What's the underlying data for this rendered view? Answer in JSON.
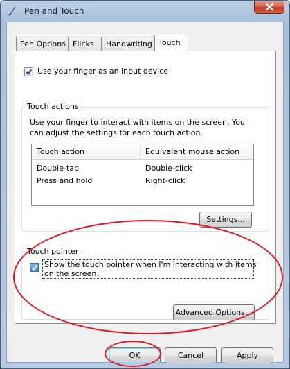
{
  "window": {
    "title": "Pen and Touch",
    "accent_close": "#c23b22"
  },
  "tabs": [
    {
      "label": "Pen Options",
      "active": false
    },
    {
      "label": "Flicks",
      "active": false
    },
    {
      "label": "Handwriting",
      "active": false
    },
    {
      "label": "Touch",
      "active": true
    }
  ],
  "use_finger": {
    "checked": true,
    "label": "Use your finger as an input device"
  },
  "touch_actions": {
    "legend": "Touch actions",
    "description_line1": "Use your finger to interact with items on the screen. You",
    "description_line2": "can adjust the settings for each touch action.",
    "columns": [
      "Touch action",
      "Equivalent mouse action"
    ],
    "rows": [
      {
        "action": "Double-tap",
        "mouse": "Double-click"
      },
      {
        "action": "Press and hold",
        "mouse": "Right-click"
      }
    ],
    "settings_button": "Settings..."
  },
  "touch_pointer": {
    "legend": "Touch pointer",
    "checked": true,
    "label_line1": "Show the touch pointer when I'm interacting with items",
    "label_line2": "on the screen.",
    "advanced_button": "Advanced Options..."
  },
  "buttons": {
    "ok": "OK",
    "cancel": "Cancel",
    "apply": "Apply"
  },
  "annotation_color": "#e4161f"
}
